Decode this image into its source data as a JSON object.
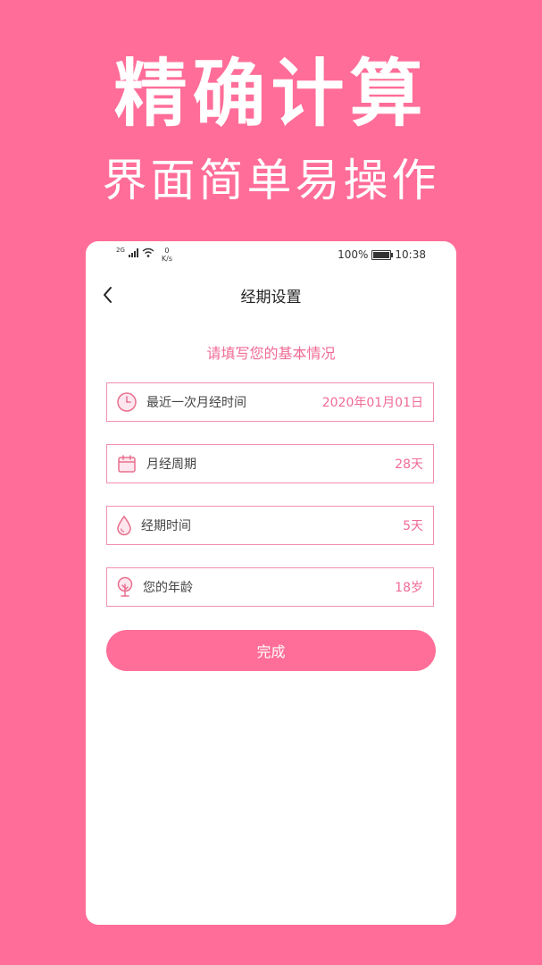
{
  "promo": {
    "title": "精确计算",
    "subtitle": "界面简单易操作"
  },
  "statusbar": {
    "network": "2G",
    "speed_value": "0",
    "speed_unit": "K/s",
    "battery": "100%",
    "time": "10:38"
  },
  "nav": {
    "title": "经期设置"
  },
  "form": {
    "prompt": "请填写您的基本情况",
    "fields": [
      {
        "icon": "clock-icon",
        "label": "最近一次月经时间",
        "value": "2020年01月01日"
      },
      {
        "icon": "calendar-icon",
        "label": "月经周期",
        "value": "28天"
      },
      {
        "icon": "drop-icon",
        "label": "经期时间",
        "value": "5天"
      },
      {
        "icon": "tree-icon",
        "label": "您的年龄",
        "value": "18岁"
      }
    ],
    "submit_label": "完成"
  },
  "colors": {
    "background": "#ff6d98",
    "accent": "#f06b95",
    "button": "#fe6e98",
    "field_border": "#f08fb0"
  }
}
